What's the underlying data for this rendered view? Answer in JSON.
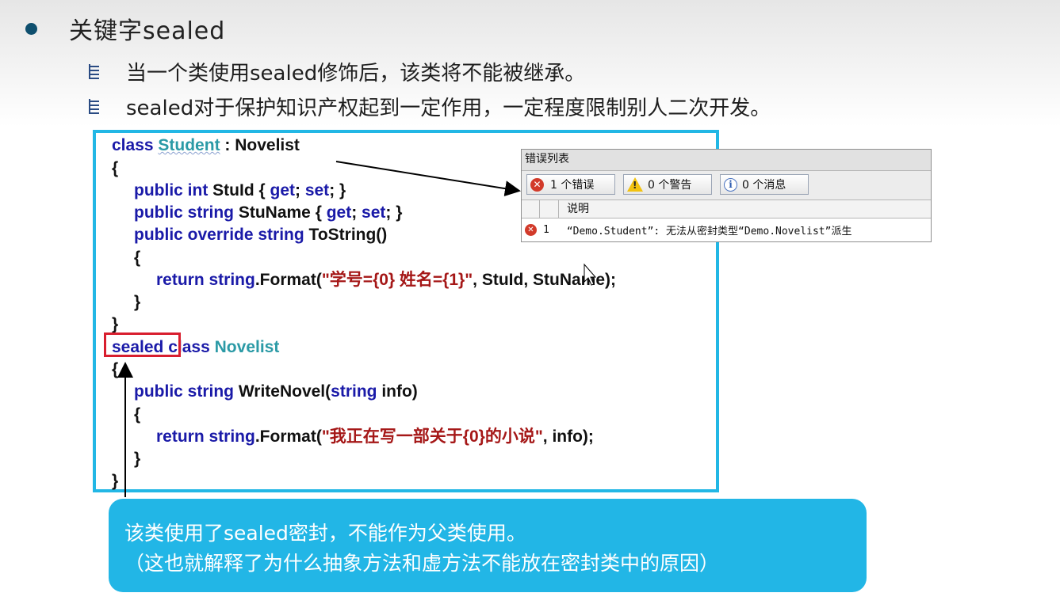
{
  "slide": {
    "title": "关键字sealed",
    "bullets": [
      "当一个类使用sealed修饰后，该类将不能被继承。",
      "sealed对于保护知识产权起到一定作用，一定程度限制别人二次开发。"
    ]
  },
  "code": {
    "line1": {
      "kw": "class",
      "type": "Student",
      "rest": " : Novelist"
    },
    "line2": "{",
    "line3": {
      "kw": "public int",
      "rest1": " StuId { ",
      "kw2": "get",
      "rest2": "; ",
      "kw3": "set",
      "rest3": "; }"
    },
    "line4": {
      "kw": "public string",
      "rest1": " StuName { ",
      "kw2": "get",
      "rest2": "; ",
      "kw3": "set",
      "rest3": "; }"
    },
    "line5": {
      "kw": "public override string",
      "rest": " ToString()"
    },
    "line6": "{",
    "line7": {
      "kw": "return string",
      "rest1": ".Format(",
      "str": "\"学号={0} 姓名={1}\"",
      "rest2": ", StuId, StuName);"
    },
    "line8": "}",
    "line9": "}",
    "line10": {
      "kw": "sealed",
      "kw2": "class",
      "type": "Novelist"
    },
    "line11": "{",
    "line12": {
      "kw": "public string",
      "rest1": " WriteNovel(",
      "kw2": "string",
      "rest2": " info)"
    },
    "line13": "{",
    "line14": {
      "kw": "return string",
      "rest1": ".Format(",
      "str": "\"我正在写一部关于{0}的小说\"",
      "rest2": ", info);"
    },
    "line15": "}",
    "line16": "}"
  },
  "error_list": {
    "title": "错误列表",
    "errors_label": "1 个错误",
    "warnings_label": "0 个警告",
    "messages_label": "0 个消息",
    "column_description": "说明",
    "rows": [
      {
        "index": "1",
        "description": "“Demo.Student”: 无法从密封类型“Demo.Novelist”派生"
      }
    ]
  },
  "callout": {
    "line1": "该类使用了sealed密封，不能作为父类使用。",
    "line2": "（这也就解释了为什么抽象方法和虚方法不能放在密封类中的原因）"
  },
  "colors": {
    "accent": "#22b6e6",
    "highlight_border": "#d81e2e",
    "keyword": "#1a1aa8",
    "type_name": "#2b9aa6",
    "string_literal": "#a51717"
  }
}
